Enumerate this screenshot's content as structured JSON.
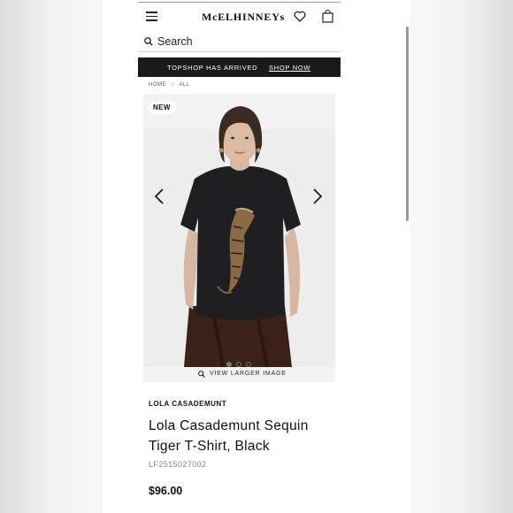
{
  "header": {
    "logo_text": "McELHINNEYs",
    "icons": [
      "menu-icon",
      "heart-icon",
      "shopping-bag-icon"
    ]
  },
  "search": {
    "label": "Search",
    "icon": "search-icon"
  },
  "banner": {
    "text": "TOPSHOP HAS ARRIVED",
    "link": "SHOP NOW",
    "background": "#1a1a1a"
  },
  "breadcrumb": {
    "items": [
      "HOME",
      "ALL"
    ],
    "separator": "›"
  },
  "gallery": {
    "badge": "NEW",
    "view_larger": "VIEW LARGER IMAGE",
    "dots_total": 3,
    "active_dot": 1
  },
  "product": {
    "brand": "LOLA CASADEMUNT",
    "title": "Lola Casademunt Sequin Tiger T-Shirt, Black",
    "sku": "LF2515027002",
    "price": "$96.00"
  }
}
